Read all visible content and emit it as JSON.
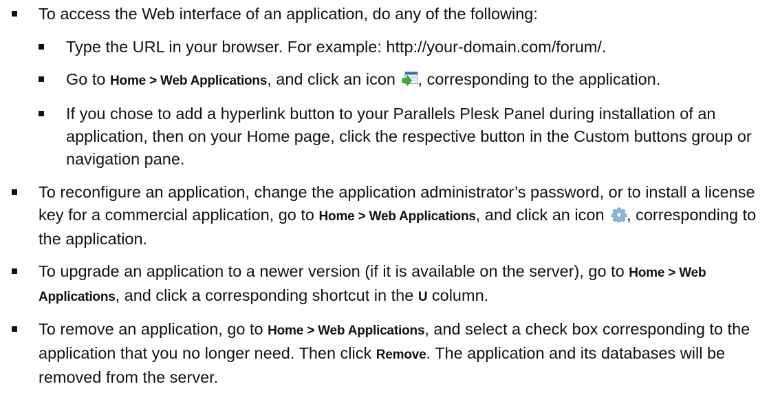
{
  "items": [
    {
      "text": "To access the Web interface of an application, do any of the following:",
      "subitems": [
        {
          "text": "Type the URL in your browser. For example: http://your-domain.com/forum/."
        },
        {
          "before": "Go to ",
          "bold": "Home > Web Applications",
          "middle": ", and click an icon ",
          "icon": "open-web-interface-icon",
          "after": ", corresponding to the application."
        },
        {
          "text": "If you chose to add a hyperlink button to your Parallels Plesk Panel during installation of an application, then on your Home page, click the respective button in the Custom buttons group or navigation pane."
        }
      ]
    },
    {
      "before": "To reconfigure an application, change the application administrator’s password, or to install a license key for a commercial application, go to ",
      "bold": "Home > Web Applications",
      "middle": ", and click an icon ",
      "icon": "gear-icon",
      "after": ", corresponding to the application."
    },
    {
      "before": "To upgrade an application to a newer version (if it is available on the server), go to ",
      "bold": "Home > Web Applications",
      "middle": ", and click a corresponding shortcut in the ",
      "bold2": "U",
      "after": " column."
    },
    {
      "before": "To remove an application, go to ",
      "bold": "Home > Web Applications",
      "middle": ", and select a check box corresponding to the application that you no longer need. Then click ",
      "bold2": "Remove",
      "after": ". The application and its databases will be removed from the server."
    }
  ]
}
